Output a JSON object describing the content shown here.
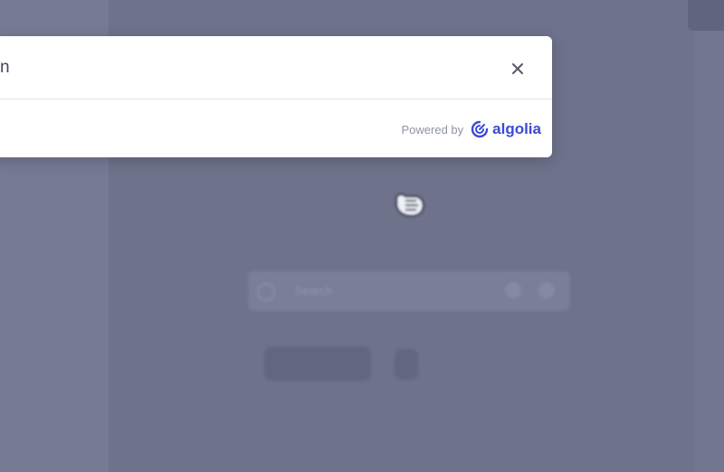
{
  "search_modal": {
    "query_value": "n",
    "clear_icon": "close-icon",
    "powered_by_label": "Powered by",
    "provider_name": "algolia",
    "provider_icon": "algolia-logo-icon",
    "accent_color": "#3a4bd8"
  },
  "background_page": {
    "search_placeholder": "Search"
  }
}
